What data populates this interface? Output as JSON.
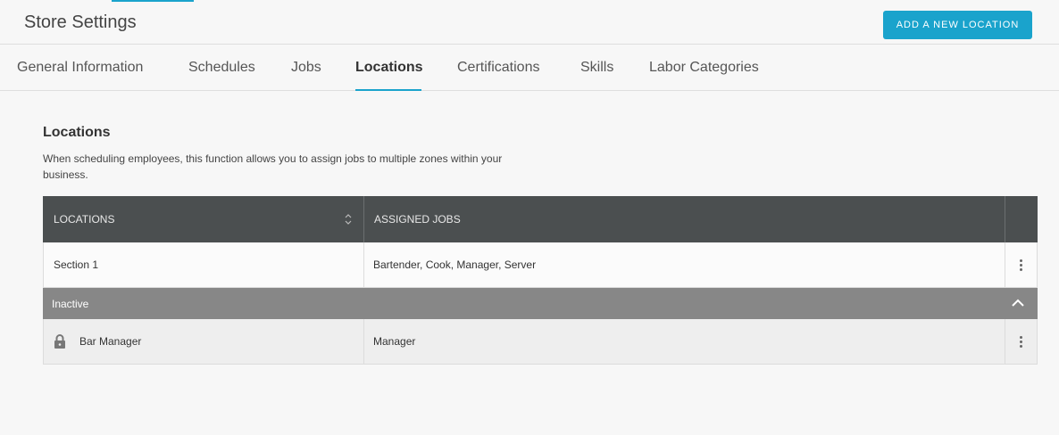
{
  "header": {
    "title": "Store Settings",
    "add_button_label": "ADD A NEW LOCATION"
  },
  "tabs": [
    {
      "label": "General Information"
    },
    {
      "label": "Schedules"
    },
    {
      "label": "Jobs"
    },
    {
      "label": "Locations",
      "active": true
    },
    {
      "label": "Certifications"
    },
    {
      "label": "Skills"
    },
    {
      "label": "Labor Categories"
    }
  ],
  "section": {
    "title": "Locations",
    "description": "When scheduling employees, this function allows you to assign jobs to multiple zones within your business."
  },
  "table": {
    "columns": [
      "LOCATIONS",
      "ASSIGNED JOBS"
    ],
    "active_rows": [
      {
        "location": "Section 1",
        "jobs": "Bartender, Cook, Manager, Server"
      }
    ],
    "inactive_group_label": "Inactive",
    "inactive_rows": [
      {
        "location": "Bar Manager",
        "jobs": "Manager"
      }
    ]
  },
  "colors": {
    "accent": "#1aa3cc",
    "table_header": "#4b4f50",
    "inactive_bar": "#878787"
  }
}
